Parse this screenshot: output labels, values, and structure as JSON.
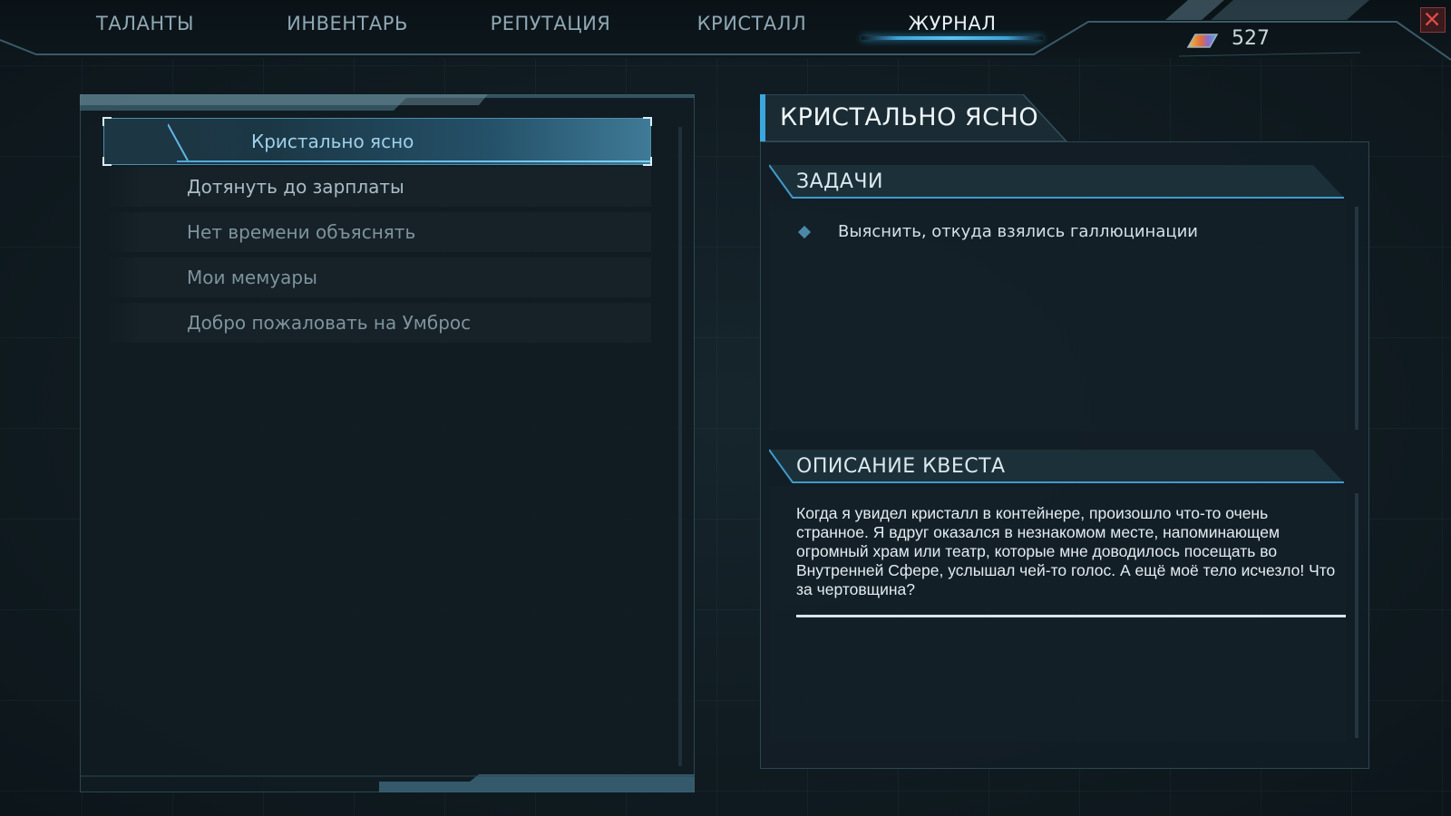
{
  "tabs": [
    {
      "label": "ТАЛАНТЫ",
      "active": false
    },
    {
      "label": "ИНВЕНТАРЬ",
      "active": false
    },
    {
      "label": "РЕПУТАЦИЯ",
      "active": false
    },
    {
      "label": "КРИСТАЛЛ",
      "active": false
    },
    {
      "label": "ЖУРНАЛ",
      "active": true
    }
  ],
  "currency": {
    "value": "527",
    "icon": "crystal-shard-icon"
  },
  "quests": [
    {
      "label": "Кристально ясно",
      "selected": true
    },
    {
      "label": "Дотянуть до зарплаты",
      "selected": false
    },
    {
      "label": "Нет времени объяснять",
      "selected": false
    },
    {
      "label": "Мои мемуары",
      "selected": false
    },
    {
      "label": "Добро пожаловать на Умброс",
      "selected": false
    }
  ],
  "detail": {
    "title": "КРИСТАЛЬНО ЯСНО",
    "tasks_header": "ЗАДАЧИ",
    "tasks": [
      "Выяснить, откуда взялись галлюцинации"
    ],
    "description_header": "ОПИСАНИЕ КВЕСТА",
    "description": "Когда я увидел кристалл в контейнере, произошло что-то очень странное. Я вдруг оказался в незнакомом месте, напоминающем огромный храм или театр, которые мне доводилось посещать во Внутренней Сфере, услышал чей-то голос. А ещё моё тело исчезло! Что за чертовщина?"
  },
  "colors": {
    "accent": "#3fa3d6",
    "panel": "#121e25",
    "close": "#c83a3a"
  }
}
